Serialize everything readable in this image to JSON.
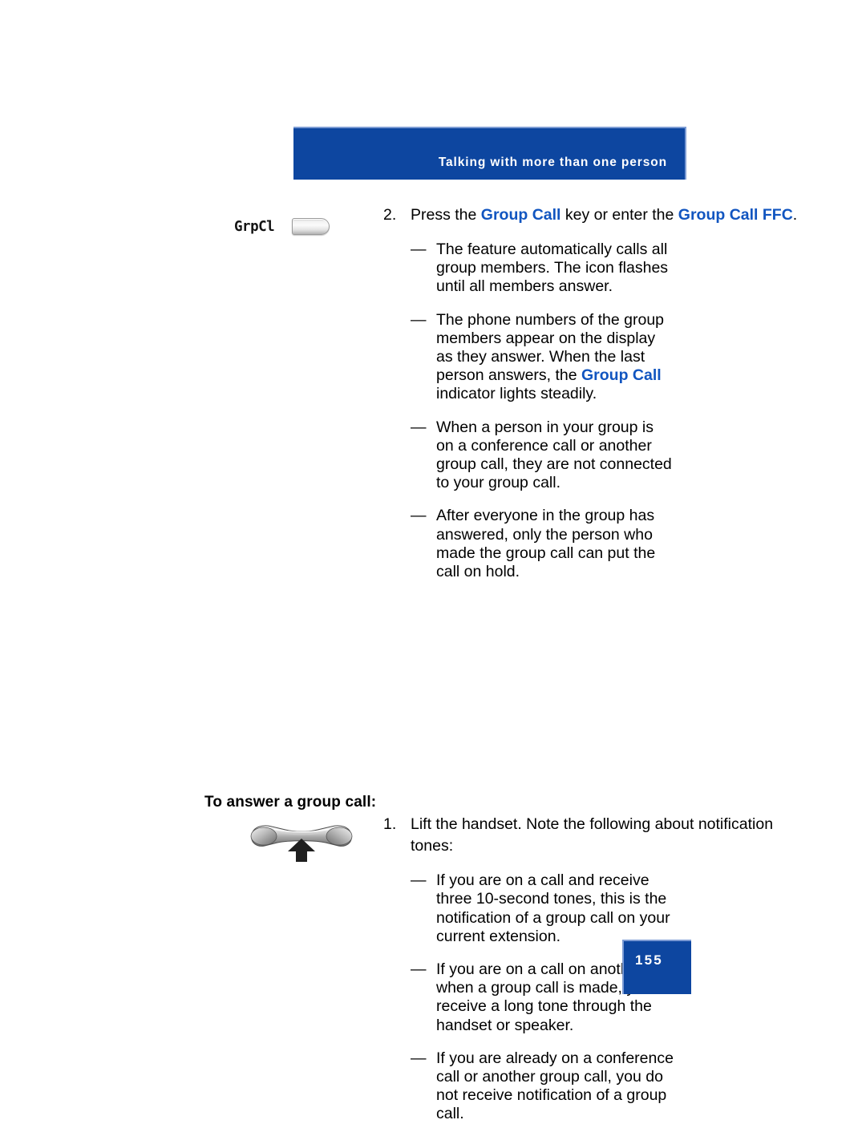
{
  "header": {
    "title": "Talking with more than one person"
  },
  "steps": [
    {
      "number": "2.",
      "icon": "feature-key-with-label",
      "key_label": "GrpCl",
      "text_parts": [
        {
          "text": "Press the ",
          "style": "normal"
        },
        {
          "text": "Group Call",
          "style": "blue-bold"
        },
        {
          "text": " key or enter the ",
          "style": "normal"
        },
        {
          "text": "Group Call FFC",
          "style": "blue-bold"
        },
        {
          "text": ".",
          "style": "normal"
        }
      ],
      "dashes": [
        {
          "mark": "—",
          "parts": [
            {
              "text": "The feature automatically calls all group members. The icon flashes until all members answer.",
              "style": "normal"
            }
          ]
        },
        {
          "mark": "—",
          "parts": [
            {
              "text": "The phone numbers of the group members appear on the display as they answer. When the last person answers, the ",
              "style": "normal"
            },
            {
              "text": "Group Call",
              "style": "blue-bold"
            },
            {
              "text": " indicator lights steadily.",
              "style": "normal"
            }
          ]
        },
        {
          "mark": "—",
          "parts": [
            {
              "text": "When a person in your group is on a conference call or another group call, they are not connected to your group call.",
              "style": "normal"
            }
          ]
        },
        {
          "mark": "—",
          "parts": [
            {
              "text": "After everyone in the group has answered, only the person who made the group call can put the call on hold.",
              "style": "normal"
            }
          ]
        }
      ]
    }
  ],
  "section_heading": "To answer a group call:",
  "steps2": [
    {
      "number": "1.",
      "icon": "lift-handset-icon",
      "text_parts": [
        {
          "text": "Lift the handset. Note the following about notification tones:",
          "style": "normal"
        }
      ],
      "dashes": [
        {
          "mark": "—",
          "parts": [
            {
              "text": "If you are on a call and receive three 10-second tones, this is the notification of a group call on your current extension.",
              "style": "normal"
            }
          ]
        },
        {
          "mark": "—",
          "parts": [
            {
              "text": "If you are on a call on another line when a group call is made, you receive a long tone through the handset or speaker.",
              "style": "normal"
            }
          ]
        },
        {
          "mark": "—",
          "parts": [
            {
              "text": "If you are already on a conference call or another group call, you do not receive notification of a group call.",
              "style": "normal"
            }
          ]
        }
      ]
    }
  ],
  "footer": {
    "page_number": "155"
  },
  "colors": {
    "banner_blue": "#0D46A0",
    "accent_blue": "#1155C0",
    "banner_edge": "#7C9BD4",
    "text_black": "#000000"
  }
}
